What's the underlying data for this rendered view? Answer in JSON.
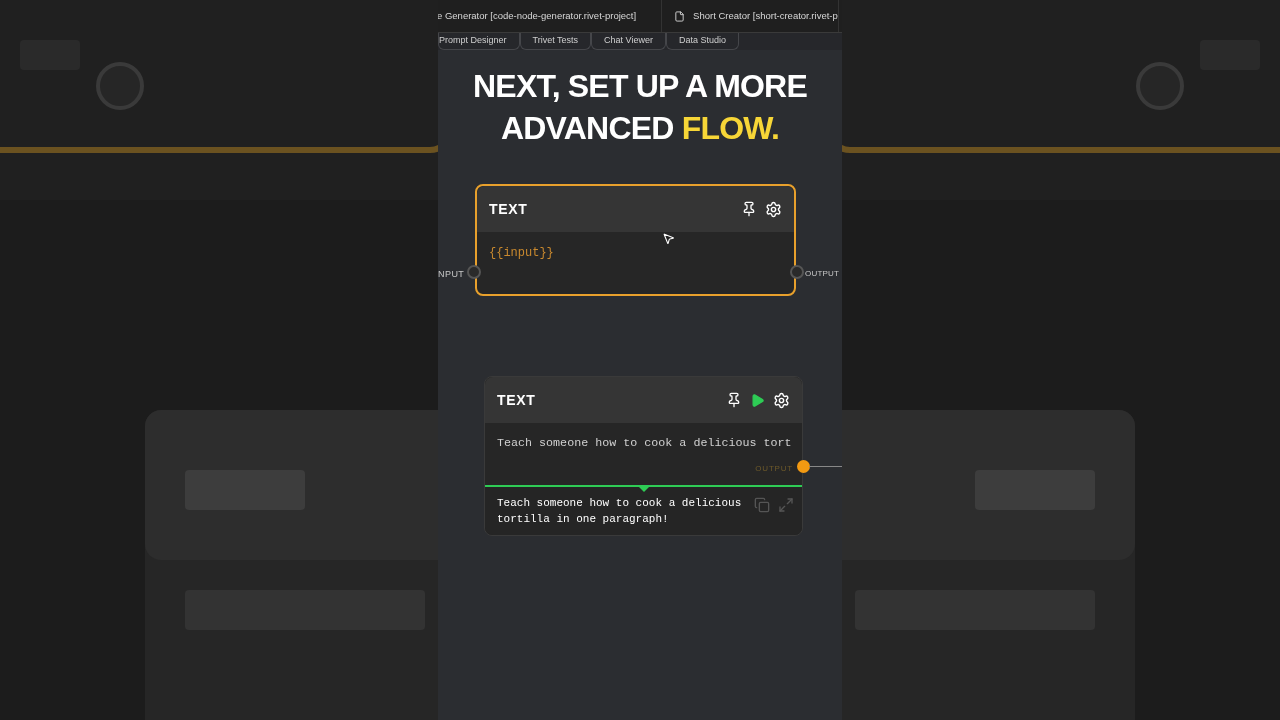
{
  "file_tabs": [
    {
      "label": "e Generator [code-node-generator.rivet-project]",
      "icon": false
    },
    {
      "label": "Short Creator [short-creator.rivet-p",
      "icon": true
    }
  ],
  "nav_tabs": [
    "Prompt Designer",
    "Trivet Tests",
    "Chat Viewer",
    "Data Studio"
  ],
  "caption": [
    [
      {
        "text": "NEXT, SET UP A MORE",
        "highlight": false
      }
    ],
    [
      {
        "text": "ADVANCED ",
        "highlight": false
      },
      {
        "text": "FLOW.",
        "highlight": true
      }
    ]
  ],
  "nodes": [
    {
      "title": "TEXT",
      "selected": true,
      "run_button": false,
      "body": "{{input}}",
      "input_port": "NPUT",
      "output_port": "OUTPUT",
      "output_connected": false
    },
    {
      "title": "TEXT",
      "selected": false,
      "run_button": true,
      "body": "Teach someone how to cook a delicious tort",
      "output_port": "OUTPUT",
      "output_connected": true,
      "result": "Teach someone how to cook a delicious tortilla in one paragraph!"
    }
  ]
}
